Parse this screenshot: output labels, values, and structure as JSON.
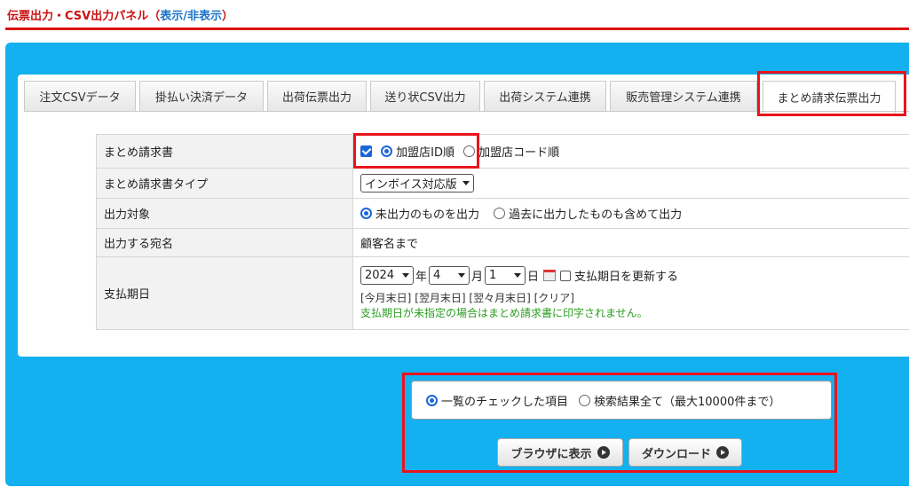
{
  "header": {
    "title": "伝票出力・CSV出力パネル",
    "toggle_open": "（",
    "toggle_label": "表示/非表示",
    "toggle_close": "）"
  },
  "tabs": [
    {
      "label": "注文CSVデータ"
    },
    {
      "label": "掛払い決済データ"
    },
    {
      "label": "出荷伝票出力"
    },
    {
      "label": "送り状CSV出力"
    },
    {
      "label": "出荷システム連携"
    },
    {
      "label": "販売管理システム連携"
    },
    {
      "label": "まとめ請求伝票出力",
      "active": true
    }
  ],
  "form": {
    "invoice": {
      "label": "まとめ請求書",
      "checked": true,
      "option1": "加盟店ID順",
      "option2": "加盟店コード順",
      "selected": "option1"
    },
    "invoice_type": {
      "label": "まとめ請求書タイプ",
      "value": "インボイス対応版"
    },
    "target": {
      "label": "出力対象",
      "option1": "未出力のものを出力",
      "option2": "過去に出力したものも含めて出力",
      "selected": "option1"
    },
    "recipient": {
      "label": "出力する宛名",
      "value": "顧客名まで"
    },
    "due_date": {
      "label": "支払期日",
      "year": "2024",
      "year_unit": "年",
      "month": "4",
      "month_unit": "月",
      "day": "1",
      "day_unit": "日",
      "update_label": "支払期日を更新する",
      "update_checked": false,
      "shortcut_this_month": "[今月末日]",
      "shortcut_next_month": "[翌月末日]",
      "shortcut_month_after": "[翌々月末日]",
      "shortcut_clear": "[クリア]",
      "note": "支払期日が未指定の場合はまとめ請求書に印字されません。"
    }
  },
  "export": {
    "option1": "一覧のチェックした項目",
    "option2": "検索結果全て（最大10000件まで）",
    "selected": "option1",
    "browser_button": "ブラウザに表示",
    "download_button": "ダウンロード"
  },
  "colors": {
    "panel_bg": "#13b1f0",
    "header_red": "#cc1111",
    "highlight_red": "#e8141d",
    "link_blue": "#1a73c8",
    "note_green": "#2a9d1f"
  }
}
